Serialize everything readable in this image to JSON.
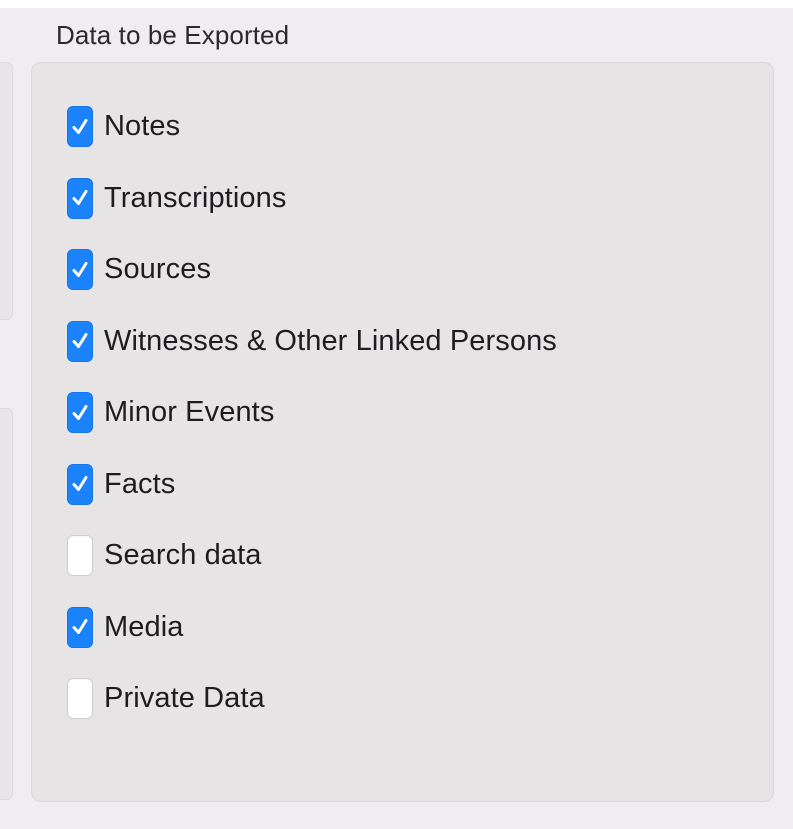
{
  "group": {
    "title": "Data to be Exported"
  },
  "options": [
    {
      "label": "Notes",
      "checked": true
    },
    {
      "label": "Transcriptions",
      "checked": true
    },
    {
      "label": "Sources",
      "checked": true
    },
    {
      "label": "Witnesses & Other Linked Persons",
      "checked": true
    },
    {
      "label": "Minor Events",
      "checked": true
    },
    {
      "label": "Facts",
      "checked": true
    },
    {
      "label": "Search data",
      "checked": false
    },
    {
      "label": "Media",
      "checked": true
    },
    {
      "label": "Private Data",
      "checked": false
    }
  ],
  "icons": {
    "checked": "checkmark-icon"
  },
  "colors": {
    "accent": "#1a82fb",
    "panel": "#e6e4e5",
    "window": "#efedf0",
    "text": "#1d1d1f"
  }
}
